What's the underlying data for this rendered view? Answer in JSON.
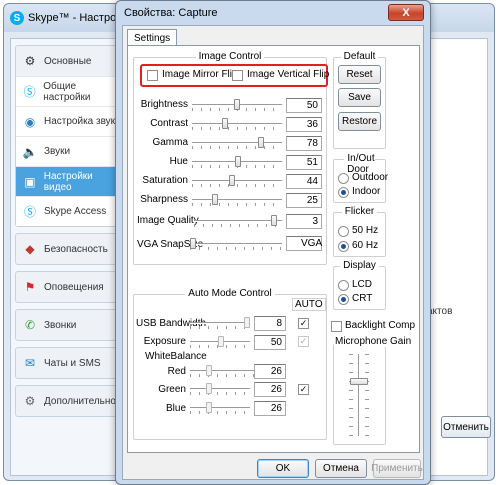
{
  "skype": {
    "title": "Skype™ - Настройки",
    "sidebar": [
      {
        "label": "Основные",
        "icon": "skype-gear-icon",
        "group_head": true
      },
      {
        "label": "Общие настройки",
        "icon": "skype-icon"
      },
      {
        "label": "Настройка звука",
        "icon": "speaker-icon"
      },
      {
        "label": "Звуки",
        "icon": "sound-icon"
      },
      {
        "label": "Настройки видео",
        "icon": "camera-icon",
        "selected": true
      },
      {
        "label": "Skype Access",
        "icon": "skype-icon"
      },
      {
        "label": "Безопасность",
        "icon": "shield-icon",
        "group_head": true
      },
      {
        "label": "Оповещения",
        "icon": "flag-icon",
        "group_head": true
      },
      {
        "label": "Звонки",
        "icon": "phone-icon",
        "group_head": true
      },
      {
        "label": "Чаты и SMS",
        "icon": "chat-icon",
        "group_head": true
      },
      {
        "label": "Дополнительно",
        "icon": "gear-icon",
        "group_head": true
      }
    ],
    "partial_text": "актов",
    "cancel_label": "Отменить"
  },
  "dialog": {
    "title": "Свойства: Capture",
    "close_glyph": "X",
    "tab": "Settings",
    "image_control": {
      "title": "Image Control",
      "mirror_flip": "Image Mirror Flip",
      "vertical_flip": "Image Vertical Flip",
      "sliders": [
        {
          "label": "Brightness",
          "value": "50"
        },
        {
          "label": "Contrast",
          "value": "36"
        },
        {
          "label": "Gamma",
          "value": "78"
        },
        {
          "label": "Hue",
          "value": "51"
        },
        {
          "label": "Saturation",
          "value": "44"
        },
        {
          "label": "Sharpness",
          "value": "25"
        }
      ],
      "quality_label": "Image Quality",
      "quality_value": "3",
      "snapsize_label": "VGA SnapSize",
      "snapsize_value": "VGA"
    },
    "default": {
      "title": "Default",
      "reset": "Reset",
      "save": "Save",
      "restore": "Restore"
    },
    "inout": {
      "title": "In/Out Door",
      "outdoor": "Outdoor",
      "indoor": "Indoor"
    },
    "flicker": {
      "title": "Flicker",
      "hz50": "50 Hz",
      "hz60": "60 Hz"
    },
    "display": {
      "title": "Display",
      "lcd": "LCD",
      "crt": "CRT"
    },
    "backlight": "Backlight Comp",
    "mic_gain": "Microphone Gain",
    "auto_mode": {
      "title": "Auto Mode Control",
      "auto": "AUTO",
      "usb_label": "USB Bandwidth",
      "usb_value": "8",
      "exposure_label": "Exposure",
      "exposure_value": "50",
      "wb_label": "WhiteBalance",
      "red_label": "Red",
      "red_value": "26",
      "green_label": "Green",
      "green_value": "26",
      "blue_label": "Blue",
      "blue_value": "26"
    },
    "buttons": {
      "ok": "OK",
      "cancel": "Отмена",
      "apply": "Применить"
    }
  }
}
